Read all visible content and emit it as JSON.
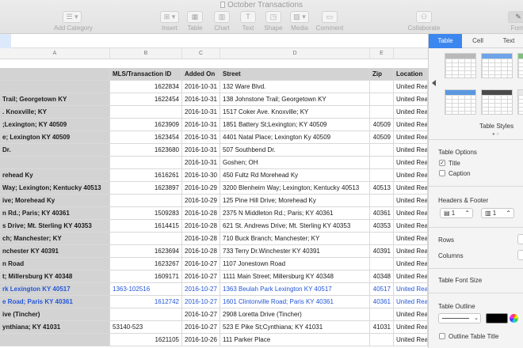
{
  "window": {
    "title": "October Transactions"
  },
  "toolbar": {
    "items": [
      {
        "label": "Add Category",
        "icon": "list-icon"
      },
      {
        "label": "Insert",
        "icon": "insert-icon"
      },
      {
        "label": "Table",
        "icon": "table-icon"
      },
      {
        "label": "Chart",
        "icon": "chart-icon"
      },
      {
        "label": "Text",
        "icon": "text-icon"
      },
      {
        "label": "Shape",
        "icon": "shape-icon"
      },
      {
        "label": "Media",
        "icon": "media-icon"
      },
      {
        "label": "Comment",
        "icon": "comment-icon"
      },
      {
        "label": "Collaborate",
        "icon": "collaborate-icon"
      },
      {
        "label": "Form",
        "icon": "format-icon"
      }
    ]
  },
  "sheet": {
    "columns": [
      "A",
      "B",
      "C",
      "D",
      "E"
    ],
    "header": [
      "",
      "MLS/Transaction ID",
      "Added On",
      "Street",
      "Zip",
      "Location"
    ],
    "rows": [
      {
        "a": "",
        "b": "1622834",
        "c": "2016-10-31",
        "d": "132 Ware Blvd.",
        "e": "",
        "f": "United Real"
      },
      {
        "a": "Trail; Georgetown KY",
        "b": "1622454",
        "c": "2016-10-31",
        "d": "138 Johnstone Trail; Georgetown KY",
        "e": "",
        "f": "United Real"
      },
      {
        "a": ". Knoxville; KY",
        "b": "",
        "c": "2016-10-31",
        "d": "1517 Coker Ave. Knoxville; KY",
        "e": "",
        "f": "United Real"
      },
      {
        "a": ";Lexington; KY 40509",
        "b": "1623909",
        "c": "2016-10-31",
        "d": "1851 Battery St;Lexington; KY 40509",
        "e": "40509",
        "f": "United Real"
      },
      {
        "a": "e; Lexington KY 40509",
        "b": "1623454",
        "c": "2016-10-31",
        "d": "4401 Natal Place; Lexington Ky 40509",
        "e": "40509",
        "f": "United Real"
      },
      {
        "a": "Dr.",
        "b": "1623680",
        "c": "2016-10-31",
        "d": "507 Southbend Dr.",
        "e": "",
        "f": "United Real"
      },
      {
        "a": "",
        "b": "",
        "c": "2016-10-31",
        "d": "Goshen; OH",
        "e": "",
        "f": "United Real"
      },
      {
        "a": "rehead Ky",
        "b": "1616261",
        "c": "2016-10-30",
        "d": "450 Fultz Rd Morehead Ky",
        "e": "",
        "f": "United Real"
      },
      {
        "a": "Way; Lexington; Kentucky 40513",
        "b": "1623897",
        "c": "2016-10-29",
        "d": "3200 Blenheim Way; Lexington; Kentucky 40513",
        "e": "40513",
        "f": "United Real"
      },
      {
        "a": "ive; Morehead Ky",
        "b": "",
        "c": "2016-10-29",
        "d": "125 Pine Hill Drive; Morehead Ky",
        "e": "",
        "f": "United Real"
      },
      {
        "a": "n Rd.; Paris; KY 40361",
        "b": "1509283",
        "c": "2016-10-28",
        "d": "2375 N Middleton Rd.; Paris; KY 40361",
        "e": "40361",
        "f": "United Real"
      },
      {
        "a": "s Drive; Mt. Sterling KY 40353",
        "b": "1614415",
        "c": "2016-10-28",
        "d": "621 St. Andrews Drive; Mt. Sterling KY 40353",
        "e": "40353",
        "f": "United Real"
      },
      {
        "a": "ch; Manchester; KY",
        "b": "",
        "c": "2016-10-28",
        "d": "710 Buck Branch; Manchester; KY",
        "e": "",
        "f": "United Real"
      },
      {
        "a": "nchester KY 40391",
        "b": "1623694",
        "c": "2016-10-28",
        "d": "733 Terry Dr.Winchester KY 40391",
        "e": "40391",
        "f": "United Real"
      },
      {
        "a": "n Road",
        "b": "1623267",
        "c": "2016-10-27",
        "d": "1107 Jonestown Road",
        "e": "",
        "f": "United Real"
      },
      {
        "a": "t; Millersburg KY 40348",
        "b": "1609171",
        "c": "2016-10-27",
        "d": "1111 Main Street; Millersburg KY 40348",
        "e": "40348",
        "f": "United Real"
      },
      {
        "a": "rk Lexington KY 40517",
        "b": "1363-102516",
        "c": "2016-10-27",
        "d": "1363 Beulah Park Lexington KY 40517",
        "e": "40517",
        "f": "United Real",
        "link": true
      },
      {
        "a": "e Road; Paris KY 40361",
        "b": "1612742",
        "c": "2016-10-27",
        "d": "1601 Clintonville Road; Paris KY 40361",
        "e": "40361",
        "f": "United Real",
        "link": true
      },
      {
        "a": "ive (Tincher)",
        "b": "",
        "c": "2016-10-27",
        "d": "2908 Loretta Drive (Tincher)",
        "e": "",
        "f": "United Real"
      },
      {
        "a": "ynthiana; KY 41031",
        "b": "53140-523",
        "c": "2016-10-27",
        "d": "523 E Pike St;Cynthiana; KY 41031",
        "e": "41031",
        "f": "United Real"
      },
      {
        "a": "",
        "b": "1621105",
        "c": "2016-10-26",
        "d": "111 Parker Place",
        "e": "",
        "f": "United Real"
      }
    ]
  },
  "inspector": {
    "tabs": [
      "Table",
      "Cell",
      "Text"
    ],
    "active_tab": "Table",
    "table_styles_label": "Table Styles",
    "table_options_label": "Table Options",
    "title_option": {
      "label": "Title",
      "checked": true
    },
    "caption_option": {
      "label": "Caption",
      "checked": false
    },
    "headers_footer_label": "Headers & Footer",
    "header_rows_value": "1",
    "header_cols_value": "1",
    "rows_label": "Rows",
    "columns_label": "Columns",
    "font_size_label": "Table Font Size",
    "outline_label": "Table Outline",
    "outline_title_label": "Outline Table Title",
    "accent_color": "#3b86ef"
  }
}
